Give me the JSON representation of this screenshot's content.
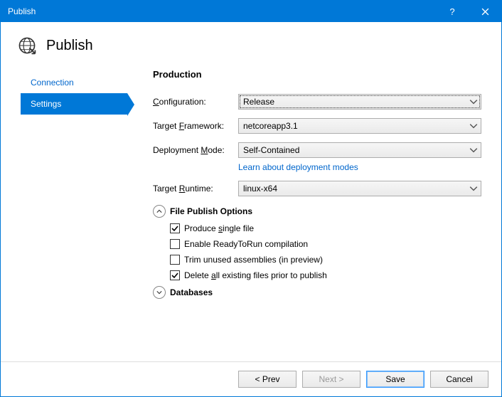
{
  "titlebar": {
    "title": "Publish"
  },
  "header": {
    "title": "Publish"
  },
  "nav": {
    "items": [
      {
        "label": "Connection",
        "selected": false
      },
      {
        "label": "Settings",
        "selected": true
      }
    ]
  },
  "content": {
    "section_title": "Production",
    "configuration": {
      "label": "Configuration:",
      "value": "Release"
    },
    "target_framework": {
      "label": "Target Framework:",
      "value": "netcoreapp3.1"
    },
    "deployment_mode": {
      "label": "Deployment Mode:",
      "value": "Self-Contained",
      "link": "Learn about deployment modes"
    },
    "target_runtime": {
      "label": "Target Runtime:",
      "value": "linux-x64"
    },
    "file_publish_options": {
      "title": "File Publish Options",
      "expanded": true,
      "items": [
        {
          "label": "Produce single file",
          "checked": true
        },
        {
          "label": "Enable ReadyToRun compilation",
          "checked": false
        },
        {
          "label": "Trim unused assemblies (in preview)",
          "checked": false
        },
        {
          "label": "Delete all existing files prior to publish",
          "checked": true
        }
      ]
    },
    "databases": {
      "title": "Databases",
      "expanded": false
    }
  },
  "footer": {
    "prev": "< Prev",
    "next": "Next >",
    "save": "Save",
    "cancel": "Cancel"
  }
}
